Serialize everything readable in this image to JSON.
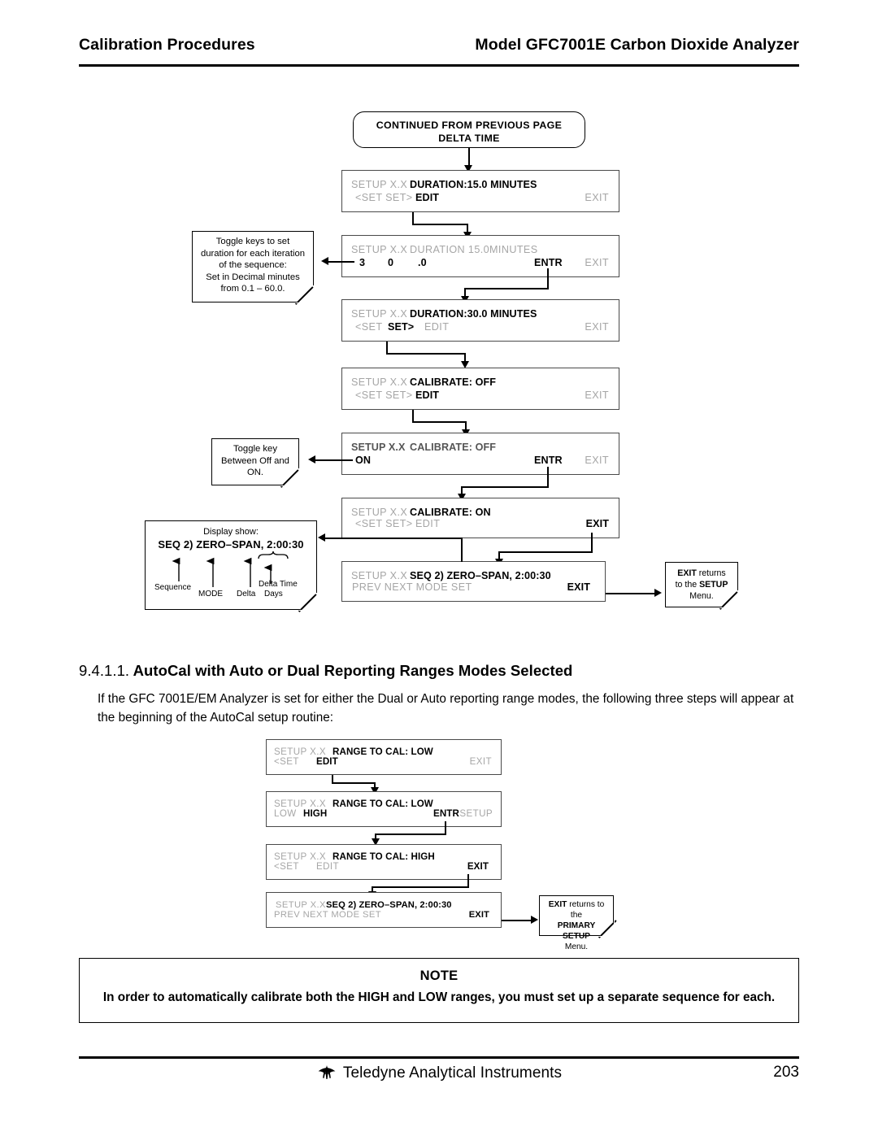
{
  "header": {
    "left": "Calibration Procedures",
    "right": "Model GFC7001E Carbon Dioxide Analyzer"
  },
  "flow_top": {
    "terminator": {
      "line1": "CONTINUED FROM PREVIOUS PAGE",
      "line2": "DELTA TIME"
    },
    "boxes": [
      {
        "id": "duration-15",
        "row1": [
          {
            "text": "SETUP X.X",
            "style": "dim"
          },
          {
            "text": "DURATION:15.0 MINUTES",
            "style": "strong"
          }
        ],
        "row2": [
          {
            "text": "<SET  SET>",
            "style": "dim"
          },
          {
            "text": "EDIT",
            "style": "strong"
          },
          {
            "text": "EXIT",
            "style": "dim"
          }
        ]
      },
      {
        "id": "duration-entry",
        "row1": [
          {
            "text": "SETUP X.X",
            "style": "dim"
          },
          {
            "text": "DURATION 15.0MINUTES",
            "style": "dim"
          }
        ],
        "row2": [
          {
            "text": "3",
            "style": "strong"
          },
          {
            "text": "0",
            "style": "strong"
          },
          {
            "text": ".0",
            "style": "strong"
          },
          {
            "text": "ENTR",
            "style": "strong"
          },
          {
            "text": "EXIT",
            "style": "dim"
          }
        ]
      },
      {
        "id": "duration-30",
        "row1": [
          {
            "text": "SETUP X.X",
            "style": "dim"
          },
          {
            "text": "DURATION:30.0 MINUTES",
            "style": "strong"
          }
        ],
        "row2": [
          {
            "text": "<SET",
            "style": "dim"
          },
          {
            "text": "SET>",
            "style": "strong"
          },
          {
            "text": "EDIT",
            "style": "dim"
          },
          {
            "text": "EXIT",
            "style": "dim"
          }
        ]
      },
      {
        "id": "calibrate-off",
        "row1": [
          {
            "text": "SETUP X.X",
            "style": "dim"
          },
          {
            "text": "CALIBRATE: OFF",
            "style": "strong"
          }
        ],
        "row2": [
          {
            "text": "<SET  SET>",
            "style": "dim"
          },
          {
            "text": "EDIT",
            "style": "strong"
          },
          {
            "text": "EXIT",
            "style": "dim"
          }
        ]
      },
      {
        "id": "calibrate-toggle",
        "row1": [
          {
            "text": "SETUP X.X",
            "style": "semi"
          },
          {
            "text": "CALIBRATE: OFF",
            "style": "semi"
          }
        ],
        "row2": [
          {
            "text": "ON",
            "style": "strong"
          },
          {
            "text": "ENTR",
            "style": "strong"
          },
          {
            "text": "EXIT",
            "style": "dim"
          }
        ]
      },
      {
        "id": "calibrate-on",
        "row1": [
          {
            "text": "SETUP X.X",
            "style": "dim"
          },
          {
            "text": "CALIBRATE: ON",
            "style": "strong"
          }
        ],
        "row2": [
          {
            "text": "<SET  SET>",
            "style": "dim"
          },
          {
            "text": "EDIT",
            "style": "dim"
          },
          {
            "text": "EXIT",
            "style": "strong"
          }
        ]
      },
      {
        "id": "seq-summary",
        "row1": [
          {
            "text": "SETUP X.X",
            "style": "dim"
          },
          {
            "text": "SEQ 2) ZERO–SPAN,  2:00:30",
            "style": "strong"
          }
        ],
        "row2": [
          {
            "text": "PREV  NEXT  MODE  SET",
            "style": "dim"
          },
          {
            "text": "EXIT",
            "style": "strong"
          }
        ]
      }
    ],
    "note_duration": [
      "Toggle keys to set",
      "duration for each iteration",
      "of the sequence:",
      "Set in Decimal minutes",
      "from 0.1 – 60.0."
    ],
    "note_toggle": [
      "Toggle key",
      "Between Off and",
      "ON."
    ],
    "note_display": {
      "caption": "Display show:",
      "value": "SEQ 2) ZERO–SPAN,  2:00:30",
      "labels": {
        "sequence": "Sequence",
        "mode": "MODE",
        "delta": "Delta",
        "days": "Days",
        "delta_time": "Delta Time"
      }
    },
    "note_exit": {
      "line1_bold": "EXIT",
      "line1_rest": " returns",
      "line2_pre": "to the ",
      "line2_bold": "SETUP",
      "line3": "Menu."
    }
  },
  "section": {
    "number": "9.4.1.1.",
    "title": "AutoCal with Auto or Dual Reporting Ranges Modes Selected",
    "paragraph": "If the GFC 7001E/EM Analyzer is set for either the Dual or Auto reporting range modes, the following three steps will appear at the beginning of the AutoCal setup routine:"
  },
  "flow_bottom": {
    "boxes": [
      {
        "id": "range-to-cal-low-1",
        "row1": [
          {
            "text": "SETUP X.X",
            "style": "dim"
          },
          {
            "text": "RANGE TO CAL: LOW",
            "style": "strong"
          }
        ],
        "row2": [
          {
            "text": "<SET",
            "style": "dim"
          },
          {
            "text": "EDIT",
            "style": "strong"
          },
          {
            "text": "EXIT",
            "style": "dim"
          }
        ]
      },
      {
        "id": "range-to-cal-low-2",
        "row1": [
          {
            "text": "SETUP X.X",
            "style": "dim"
          },
          {
            "text": "RANGE TO CAL: LOW",
            "style": "strong"
          }
        ],
        "row2": [
          {
            "text": "LOW",
            "style": "dim"
          },
          {
            "text": "HIGH",
            "style": "strong"
          },
          {
            "text": "ENTR",
            "style": "strong"
          },
          {
            "text": "SETUP",
            "style": "dim"
          }
        ]
      },
      {
        "id": "range-to-cal-high",
        "row1": [
          {
            "text": "SETUP X.X",
            "style": "dim"
          },
          {
            "text": "RANGE TO CAL: HIGH",
            "style": "strong"
          }
        ],
        "row2": [
          {
            "text": "<SET",
            "style": "dim"
          },
          {
            "text": "EDIT",
            "style": "dim"
          },
          {
            "text": "EXIT",
            "style": "strong"
          }
        ]
      },
      {
        "id": "seq-summary-2",
        "row1": [
          {
            "text": "SETUP X.X",
            "style": "dim"
          },
          {
            "text": "SEQ 2) ZERO–SPAN,  2:00:30",
            "style": "strong"
          }
        ],
        "row2": [
          {
            "text": "PREV  NEXT  MODE  SET",
            "style": "dim"
          },
          {
            "text": "EXIT",
            "style": "strong"
          }
        ]
      }
    ],
    "note_exit": {
      "line1_bold": "EXIT",
      "line1_rest": " returns to the",
      "line2_bold": "PRIMARY SETUP",
      "line3": "Menu."
    }
  },
  "note_box": {
    "title": "NOTE",
    "body": "In order to automatically calibrate both the HIGH and LOW ranges, you must set up a separate sequence for each."
  },
  "footer": {
    "company": "Teledyne Analytical Instruments",
    "page": "203"
  }
}
